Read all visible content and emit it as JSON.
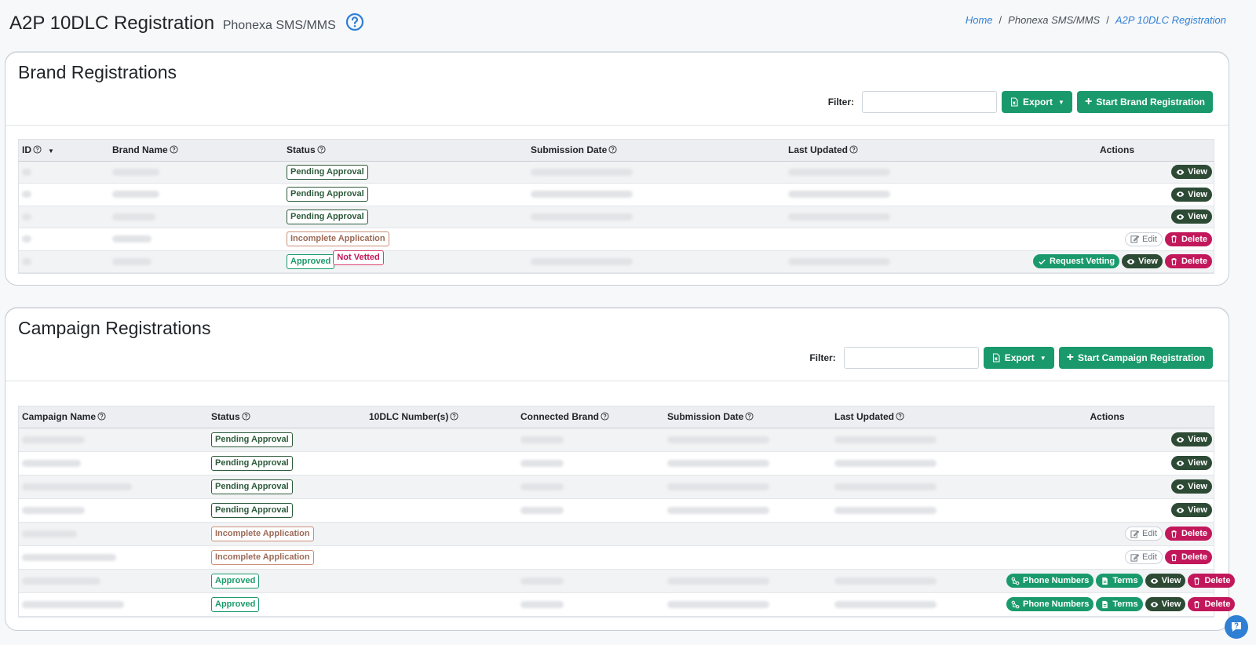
{
  "header": {
    "title": "A2P 10DLC Registration",
    "subtitle": "Phonexa SMS/MMS",
    "breadcrumb": [
      "Home",
      "Phonexa SMS/MMS",
      "A2P 10DLC Registration"
    ]
  },
  "brand": {
    "title": "Brand Registrations",
    "filter_label": "Filter:",
    "export_label": "Export",
    "start_label": "Start Brand Registration",
    "columns": [
      "ID",
      "Brand Name",
      "Status",
      "Submission Date",
      "Last Updated",
      "Actions"
    ],
    "rows": [
      {
        "status": "Pending Approval",
        "status_type": "pending",
        "actions": [
          "View"
        ]
      },
      {
        "status": "Pending Approval",
        "status_type": "pending",
        "actions": [
          "View"
        ]
      },
      {
        "status": "Pending Approval",
        "status_type": "pending",
        "actions": [
          "View"
        ]
      },
      {
        "status": "Incomplete Application",
        "status_type": "incomplete",
        "actions": [
          "Edit",
          "Delete"
        ]
      },
      {
        "status": "Approved",
        "status_type": "approved",
        "extra_badge": "Not Vetted",
        "actions": [
          "Request Vetting",
          "View",
          "Delete"
        ]
      }
    ]
  },
  "campaign": {
    "title": "Campaign Registrations",
    "filter_label": "Filter:",
    "export_label": "Export",
    "start_label": "Start Campaign Registration",
    "columns": [
      "Campaign Name",
      "Status",
      "10DLC Number(s)",
      "Connected Brand",
      "Submission Date",
      "Last Updated",
      "Actions"
    ],
    "rows": [
      {
        "status": "Pending Approval",
        "status_type": "pending",
        "actions": [
          "View"
        ]
      },
      {
        "status": "Pending Approval",
        "status_type": "pending",
        "actions": [
          "View"
        ]
      },
      {
        "status": "Pending Approval",
        "status_type": "pending",
        "actions": [
          "View"
        ]
      },
      {
        "status": "Pending Approval",
        "status_type": "pending",
        "actions": [
          "View"
        ]
      },
      {
        "status": "Incomplete Application",
        "status_type": "incomplete",
        "actions": [
          "Edit",
          "Delete"
        ]
      },
      {
        "status": "Incomplete Application",
        "status_type": "incomplete",
        "actions": [
          "Edit",
          "Delete"
        ]
      },
      {
        "status": "Approved",
        "status_type": "approved",
        "actions": [
          "Phone Numbers",
          "Terms",
          "View",
          "Delete"
        ]
      },
      {
        "status": "Approved",
        "status_type": "approved",
        "actions": [
          "Phone Numbers",
          "Terms",
          "View",
          "Delete"
        ]
      }
    ]
  },
  "icons": {
    "help": "question-circle-icon",
    "export": "file-excel-icon",
    "view": "eye-icon",
    "edit": "pencil-square-icon",
    "delete": "trash-icon",
    "request_vetting": "check-icon",
    "phone_numbers": "phone-numbers-icon",
    "terms": "document-icon",
    "chat": "chat-help-icon"
  },
  "colors": {
    "primary_green": "#1a9a6c",
    "dark_green": "#2d4a35",
    "danger": "#c2185b",
    "link_blue": "#2f7fd4"
  }
}
